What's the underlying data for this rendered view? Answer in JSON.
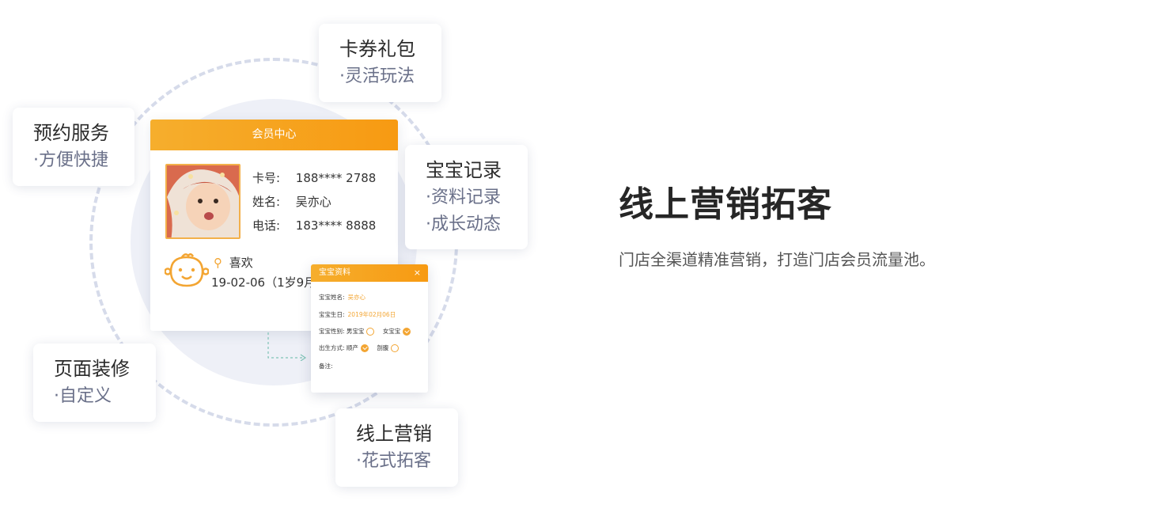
{
  "tags": {
    "coupon": {
      "title": "卡券礼包",
      "sub1": "·灵活玩法"
    },
    "booking": {
      "title": "预约服务",
      "sub1": "·方便快捷"
    },
    "baby": {
      "title": "宝宝记录",
      "sub1": "·资料记录",
      "sub2": "·成长动态"
    },
    "decor": {
      "title": "页面装修",
      "sub1": "·自定义"
    },
    "online": {
      "title": "线上营销",
      "sub1": "·花式拓客"
    }
  },
  "member_card": {
    "header": "会员中心",
    "rows": [
      {
        "label": "卡号:",
        "value": "188**** 2788"
      },
      {
        "label": "姓名:",
        "value": "吴亦心"
      },
      {
        "label": "电话:",
        "value": "183**** 8888"
      }
    ],
    "like_label": "喜欢",
    "birth_text": "19-02-06（1岁9月"
  },
  "baby_popup": {
    "header": "宝宝资料",
    "close": "×",
    "name_label": "宝宝姓名:",
    "name_value": "吴亦心",
    "birthday_label": "宝宝生日:",
    "birthday_value": "2019年02月06日",
    "gender_label": "宝宝性别:",
    "gender_male": "男宝宝",
    "gender_female": "女宝宝",
    "gender_selected": "女宝宝",
    "birth_mode_label": "出生方式:",
    "birth_mode_natural": "顺产",
    "birth_mode_csection": "剖腹",
    "birth_mode_selected": "顺产",
    "note_label": "备注:"
  },
  "hero": {
    "title": "线上营销拓客",
    "description": "门店全渠道精准营销，打造门店会员流量池。"
  },
  "colors": {
    "accent": "#f6a623",
    "ring": "#d6dbea",
    "disc": "#eef0f7",
    "sub_text": "#6a7089"
  }
}
